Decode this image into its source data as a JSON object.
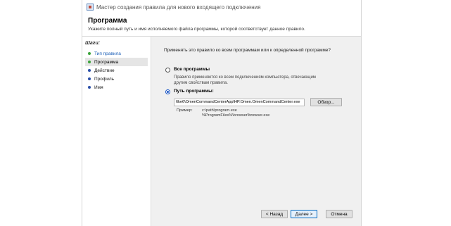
{
  "window": {
    "title": "Мастер создания правила для нового входящего подключения"
  },
  "header": {
    "title": "Программа",
    "subtitle": "Укажите полный путь и имя исполняемого файла программы, которой соответствует данное правило."
  },
  "sidebar": {
    "title": "Шаги:",
    "steps": [
      {
        "label": "Тип правила",
        "state": "completed"
      },
      {
        "label": "Программа",
        "state": "active"
      },
      {
        "label": "Действие",
        "state": "pending"
      },
      {
        "label": "Профиль",
        "state": "pending"
      },
      {
        "label": "Имя",
        "state": "pending"
      }
    ]
  },
  "content": {
    "question": "Применять это правило ко всем программам или к определенной программе?",
    "all_programs": {
      "label": "Все программы",
      "description": "Правило применяется ко всем подключениям компьютера, отвечающим другим свойствам правила.",
      "selected": false
    },
    "program_path": {
      "label": "Путь программы:",
      "value": "6ke6\\OmenCommandCenterApp\\HP.Omen.OmenCommandCenter.exe",
      "selected": true
    },
    "browse_label": "Обзор...",
    "example_label": "Пример:",
    "example_line1": "c:\\path\\program.exe",
    "example_line2": "%ProgramFiles%\\browser\\browser.exe"
  },
  "footer": {
    "back_label": "< Назад",
    "next_label": "Далее >",
    "cancel_label": "Отмена"
  },
  "colors": {
    "accent": "#0067c0",
    "step_done": "#3aa33a",
    "step_pending": "#2b4fa8"
  }
}
